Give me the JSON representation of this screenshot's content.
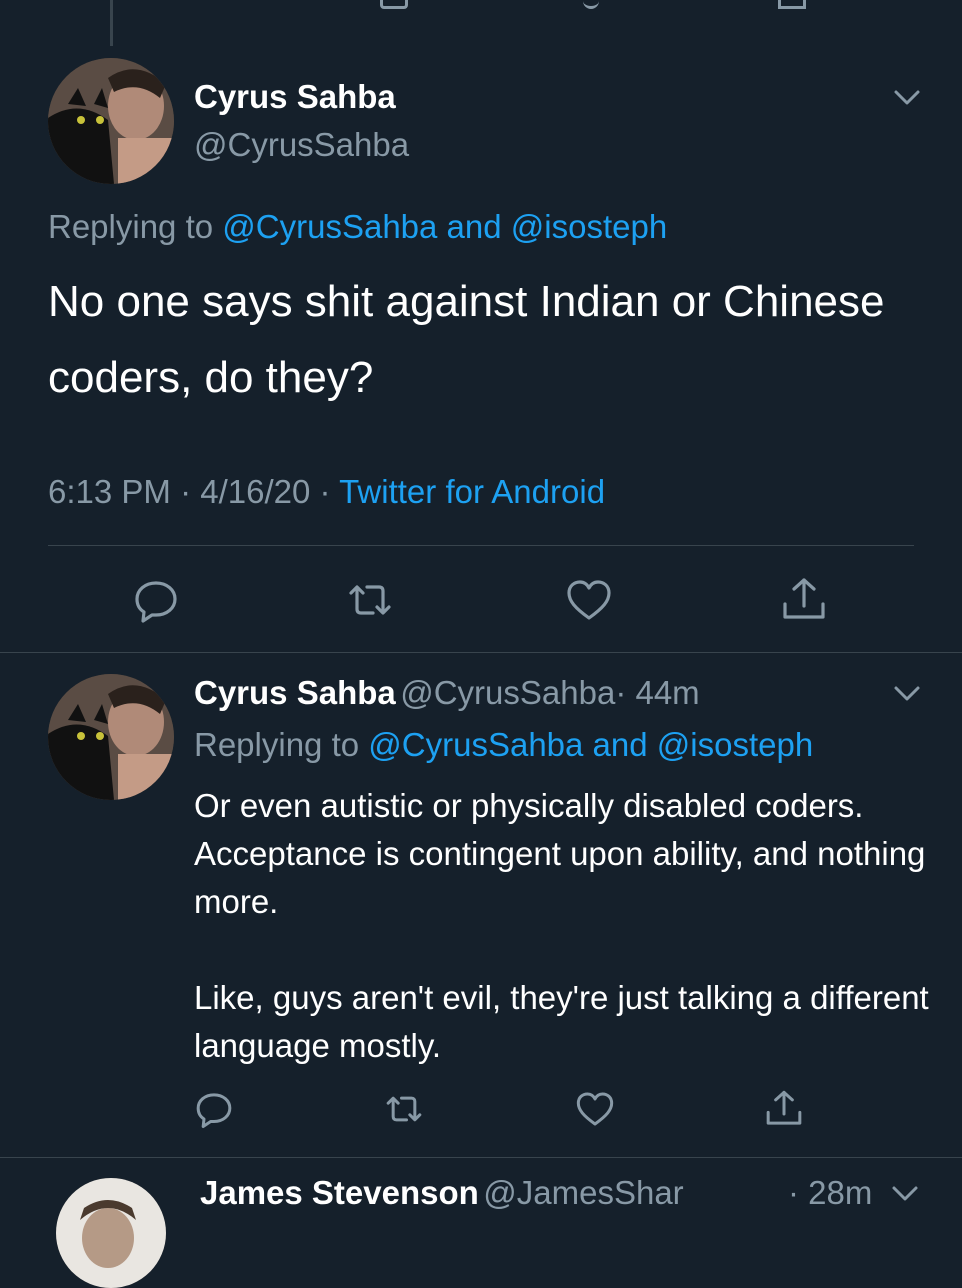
{
  "main_tweet": {
    "author_name": "Cyrus Sahba",
    "author_handle": "@CyrusSahba",
    "replying_prefix": "Replying to",
    "replying_mentions": "@CyrusSahba and @isosteph",
    "text": "No one says shit against Indian or Chinese coders, do they?",
    "time": "6:13 PM",
    "date": "4/16/20",
    "client": "Twitter for Android"
  },
  "reply_tweet": {
    "author_name": "Cyrus Sahba",
    "author_handle": "@CyrusSahba",
    "time_ago": "· 44m",
    "replying_prefix": "Replying to",
    "replying_mentions": "@CyrusSahba and @isosteph",
    "paragraphs": [
      "Or even autistic or physically disabled coders. Acceptance is contingent upon ability, and nothing more.",
      "Like, guys aren't evil, they're just talking a different language mostly."
    ]
  },
  "next_tweet": {
    "author_name": "James Stevenson",
    "author_handle": "@JamesShar",
    "time_ago": "· 28m"
  },
  "colors": {
    "background": "#15202b",
    "text": "#ffffff",
    "muted": "#8899a6",
    "link": "#1da1f2",
    "divider": "#38444d"
  },
  "icons": {
    "reply": "reply-icon",
    "retweet": "retweet-icon",
    "like": "heart-icon",
    "share": "share-icon",
    "menu": "chevron-down-icon"
  }
}
